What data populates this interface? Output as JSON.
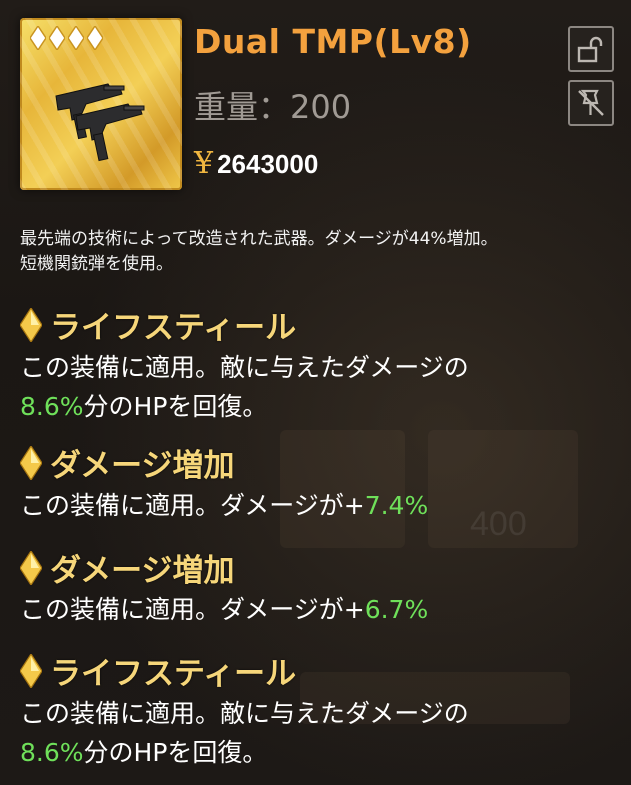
{
  "item": {
    "name": "Dual TMP(Lv8)",
    "weight_label": "重量：",
    "weight_value": "200",
    "currency_symbol": "¥",
    "price": "2643000",
    "rarity_count": 4,
    "icon": "smg-weapon-icon"
  },
  "actions": {
    "lock_icon": "unlock-icon",
    "pin_icon": "unpin-icon"
  },
  "description": {
    "line1": "最先端の技術によって改造された武器。ダメージが44%増加。",
    "line2": "短機関銃弾を使用。"
  },
  "perks": [
    {
      "title": "ライフスティール",
      "line1": "この装備に適用。敵に与えたダメージの",
      "value": "8.6%",
      "suffix": "分のHPを回復。"
    },
    {
      "title": "ダメージ増加",
      "prefix": "この装備に適用。ダメージが+",
      "value": "7.4%"
    },
    {
      "title": "ダメージ増加",
      "prefix": "この装備に適用。ダメージが+",
      "value": "6.7%"
    },
    {
      "title": "ライフスティール",
      "line1": "この装備に適用。敵に与えたダメージの",
      "value": "8.6%",
      "suffix": "分のHPを回復。"
    }
  ],
  "colors": {
    "name": "#f3a13e",
    "perk_title": "#f6d67a",
    "highlight": "#6fe05a",
    "background": "#1b1714"
  }
}
